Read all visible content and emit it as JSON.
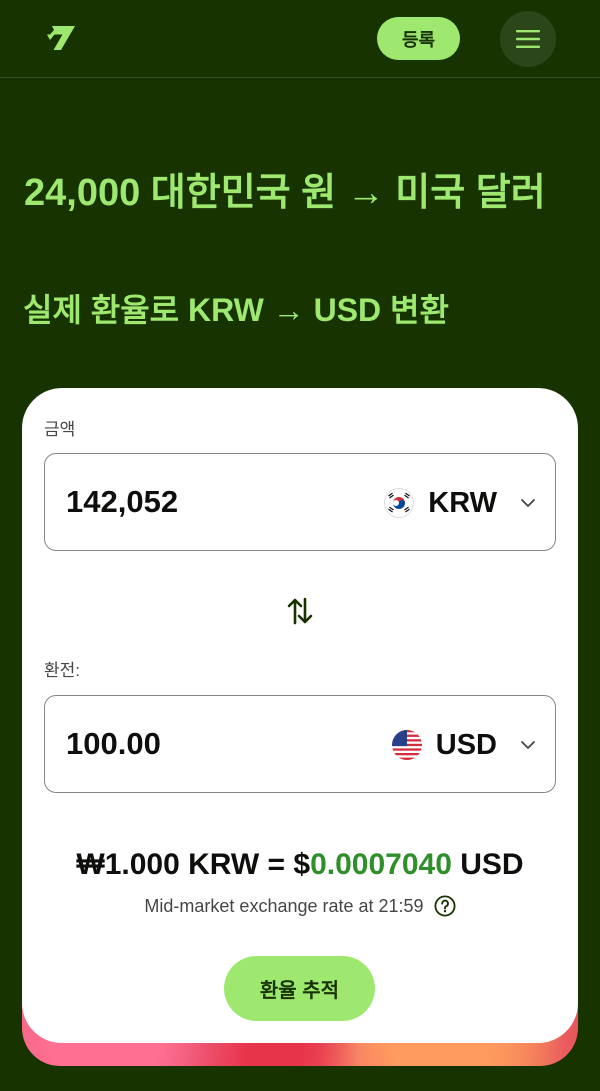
{
  "header": {
    "logo_icon": "wise-logo-icon",
    "register_label": "등록",
    "menu_icon": "hamburger-menu-icon"
  },
  "hero": {
    "title": "24,000 대한민국 원 → 미국 달러",
    "subtitle": "실제 환율로 KRW → USD 변환"
  },
  "converter": {
    "amount_label": "금액",
    "amount_value": "142,052",
    "from_currency": "KRW",
    "from_flag_icon": "south-korea-flag-icon",
    "swap_icon": "swap-arrows-icon",
    "converted_label": "환전:",
    "converted_value": "100.00",
    "to_currency": "USD",
    "to_flag_icon": "usa-flag-icon",
    "dropdown_icon": "chevron-down-icon",
    "rate": {
      "prefix": "₩1.000 KRW = $",
      "value": "0.0007040",
      "suffix": " USD"
    },
    "rate_note": "Mid-market exchange rate at 21:59",
    "info_icon": "help-circle-icon",
    "track_button": "환율 추적"
  },
  "colors": {
    "background": "#163300",
    "accent": "#9fe870",
    "card": "#ffffff",
    "rate_value": "#2f8f2a",
    "text": "#0e0f0c"
  }
}
